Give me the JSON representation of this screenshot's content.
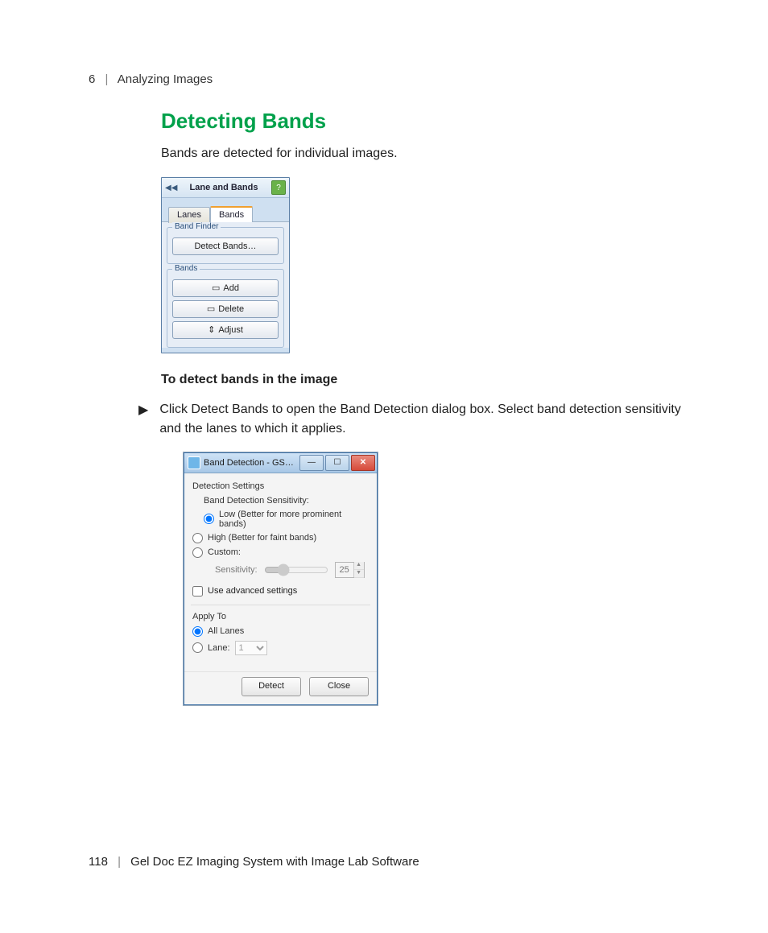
{
  "header": {
    "chapter_num": "6",
    "chapter_title": "Analyzing Images"
  },
  "section_title": "Detecting Bands",
  "intro": "Bands are detected for individual images.",
  "panel": {
    "title": "Lane and Bands",
    "help_icon": "?",
    "collapse_glyph": "◀◀",
    "tabs": {
      "lanes": "Lanes",
      "bands": "Bands"
    },
    "band_finder": {
      "legend": "Band Finder",
      "detect_btn": "Detect Bands…"
    },
    "bands_group": {
      "legend": "Bands",
      "add": "Add",
      "delete": "Delete",
      "adjust": "Adjust"
    }
  },
  "subhead": "To detect bands in the image",
  "step_arrow": "▶",
  "step_text": "Click Detect Bands to open the Band Detection dialog box. Select band detection sensitivity and the lanes to which it applies.",
  "dialog": {
    "title": "Band Detection - GS…",
    "detection_settings": "Detection Settings",
    "sensitivity_label": "Band Detection Sensitivity:",
    "opt_low": "Low (Better for more prominent bands)",
    "opt_high": "High (Better for faint bands)",
    "opt_custom": "Custom:",
    "sensitivity_word": "Sensitivity:",
    "sensitivity_value": "25",
    "use_advanced": "Use advanced settings",
    "apply_to": "Apply To",
    "all_lanes": "All Lanes",
    "lane_label": "Lane:",
    "lane_value": "1",
    "detect_btn": "Detect",
    "close_btn": "Close"
  },
  "footer": {
    "page_num": "118",
    "product": "Gel Doc EZ Imaging System with Image Lab Software"
  }
}
